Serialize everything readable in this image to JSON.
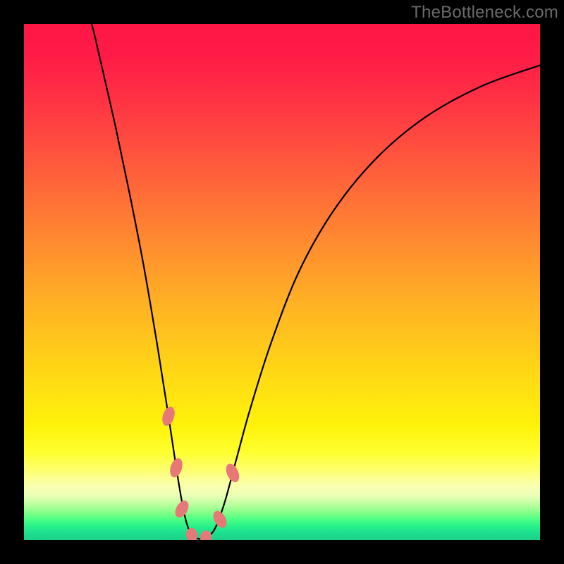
{
  "watermark": "TheBottleneck.com",
  "chart_data": {
    "type": "line",
    "title": "",
    "xlabel": "",
    "ylabel": "",
    "x_range": [
      0,
      732
    ],
    "y_range_percent": [
      0,
      100
    ],
    "curve": {
      "x": [
        96,
        110,
        130,
        150,
        170,
        190,
        205,
        216,
        226,
        234,
        244,
        256,
        270,
        284,
        300,
        320,
        350,
        390,
        440,
        500,
        570,
        650,
        732
      ],
      "y_percent": [
        100,
        92,
        80,
        67,
        53,
        37,
        24,
        14,
        6,
        2,
        0.4,
        0.4,
        2,
        7,
        15,
        25,
        38,
        52,
        64,
        74,
        82,
        88,
        92
      ]
    },
    "flat_band_y_percent": [
      0,
      3
    ],
    "markers": [
      {
        "cx": 205,
        "cy_percent": 24,
        "rx": 8,
        "ry": 14,
        "rot": 18
      },
      {
        "cx": 216,
        "cy_percent": 14,
        "rx": 8,
        "ry": 14,
        "rot": 18
      },
      {
        "cx": 224,
        "cy_percent": 6,
        "rx": 8,
        "ry": 13,
        "rot": 30
      },
      {
        "cx": 238,
        "cy_percent": 1,
        "rx": 10,
        "ry": 8,
        "rot": 80
      },
      {
        "cx": 258,
        "cy_percent": 0.5,
        "rx": 10,
        "ry": 8,
        "rot": 96
      },
      {
        "cx": 278,
        "cy_percent": 4,
        "rx": 8,
        "ry": 13,
        "rot": -30
      },
      {
        "cx": 296,
        "cy_percent": 13,
        "rx": 8,
        "ry": 14,
        "rot": -24
      }
    ],
    "colors": {
      "curve_stroke": "#000000",
      "marker_fill": "#e77878"
    }
  }
}
